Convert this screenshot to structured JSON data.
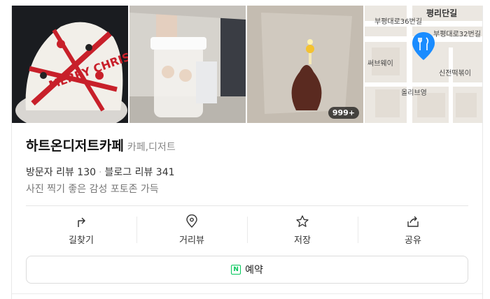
{
  "place": {
    "name": "하트온디저트카페",
    "category": "카페,디저트",
    "visitor_reviews": "방문자 리뷰 130",
    "blog_reviews": "블로그 리뷰 341",
    "description": "사진 찍기 좋은 감성 포토존 가득"
  },
  "photos": {
    "count_badge": "999+",
    "cake_text": "MERRY CHRISTMAS!"
  },
  "map": {
    "area_label": "평리단길",
    "roads": [
      "부평대로36번길",
      "부평대로32번길"
    ],
    "pois": [
      "써브웨이",
      "신전떡볶이",
      "올리브영"
    ]
  },
  "actions": [
    {
      "label": "길찾기",
      "icon": "directions-icon"
    },
    {
      "label": "거리뷰",
      "icon": "location-pin-icon"
    },
    {
      "label": "저장",
      "icon": "star-icon"
    },
    {
      "label": "공유",
      "icon": "share-icon"
    }
  ],
  "reserve": {
    "label": "예약",
    "icon_glyph": "N"
  },
  "colors": {
    "naver_green": "#03c75a",
    "map_pin_blue": "#1a8cff"
  }
}
